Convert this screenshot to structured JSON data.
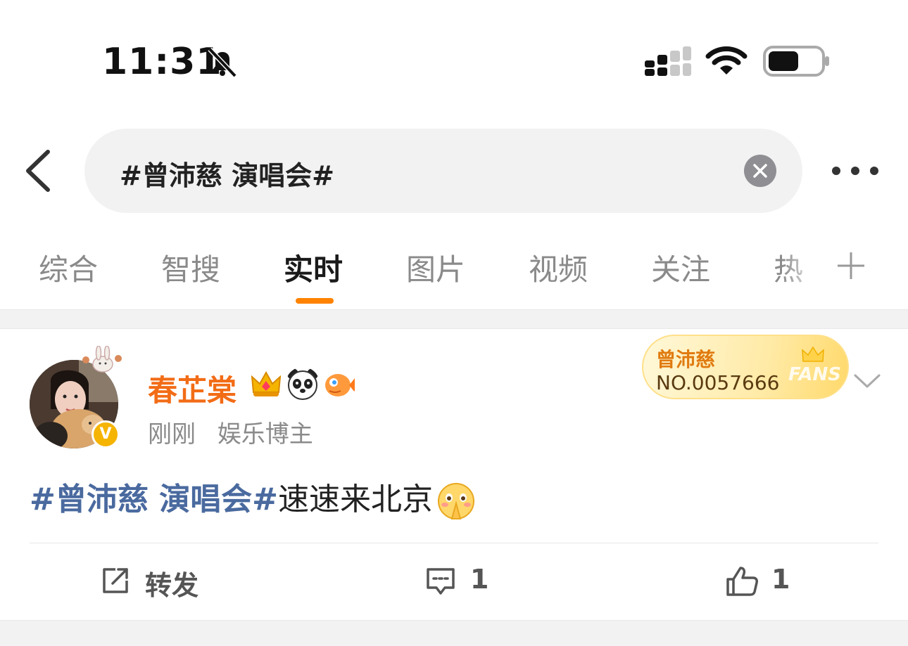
{
  "status_bar": {
    "time": "11:31",
    "icons": [
      "bell-slash-icon",
      "cellular-signal-icon",
      "wifi-icon",
      "battery-icon"
    ]
  },
  "search": {
    "query": "#曾沛慈 演唱会#",
    "icons": [
      "back-arrow-icon",
      "clear-icon",
      "more-icon"
    ]
  },
  "tabs": {
    "items": [
      {
        "label": "综合",
        "active": false
      },
      {
        "label": "智搜",
        "active": false
      },
      {
        "label": "实时",
        "active": true
      },
      {
        "label": "图片",
        "active": false
      },
      {
        "label": "视频",
        "active": false
      },
      {
        "label": "关注",
        "active": false
      },
      {
        "label": "热",
        "active": false
      }
    ],
    "accent_color": "#ff8200"
  },
  "post": {
    "username": "春芷棠",
    "username_color": "#f26c16",
    "verified_label": "V",
    "time": "刚刚",
    "role": "娱乐博主",
    "badges": [
      "crown-badge-icon",
      "panda-badge-icon",
      "fish-badge-icon"
    ],
    "fans_card": {
      "name": "曾沛慈",
      "number": "NO.0057666",
      "word": "FANS"
    },
    "body": {
      "hashtag": "#曾沛慈 演唱会#",
      "text": "速速来北京",
      "emoji": "pray-emoji-icon"
    },
    "actions": {
      "repost_label": "转发",
      "comment_count": "1",
      "like_count": "1"
    },
    "hashtag_color": "#4a6a9f"
  }
}
